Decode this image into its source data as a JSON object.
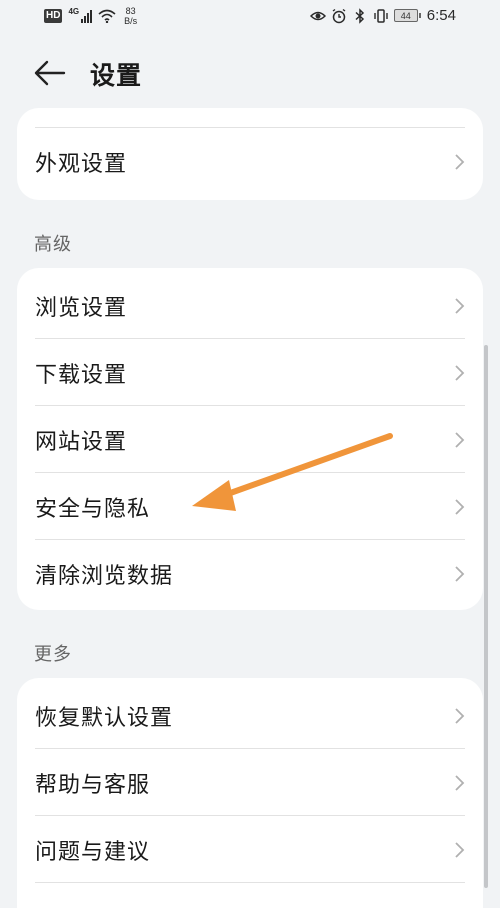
{
  "status_bar": {
    "hd": "HD",
    "network_type": "4G",
    "speed_value": "83",
    "speed_unit": "B/s",
    "battery": "44",
    "time": "6:54"
  },
  "header": {
    "back_icon": "arrow-left-icon",
    "title": "设置"
  },
  "top_card": {
    "items": [
      {
        "label": "外观设置"
      }
    ]
  },
  "section_advanced": {
    "title": "高级",
    "items": [
      {
        "label": "浏览设置"
      },
      {
        "label": "下载设置"
      },
      {
        "label": "网站设置"
      },
      {
        "label": "安全与隐私"
      },
      {
        "label": "清除浏览数据"
      }
    ]
  },
  "section_more": {
    "title": "更多",
    "items": [
      {
        "label": "恢复默认设置"
      },
      {
        "label": "帮助与客服"
      },
      {
        "label": "问题与建议"
      }
    ]
  },
  "colors": {
    "background": "#f1f3f5",
    "card": "#ffffff",
    "annotation_arrow": "#f0953a"
  }
}
